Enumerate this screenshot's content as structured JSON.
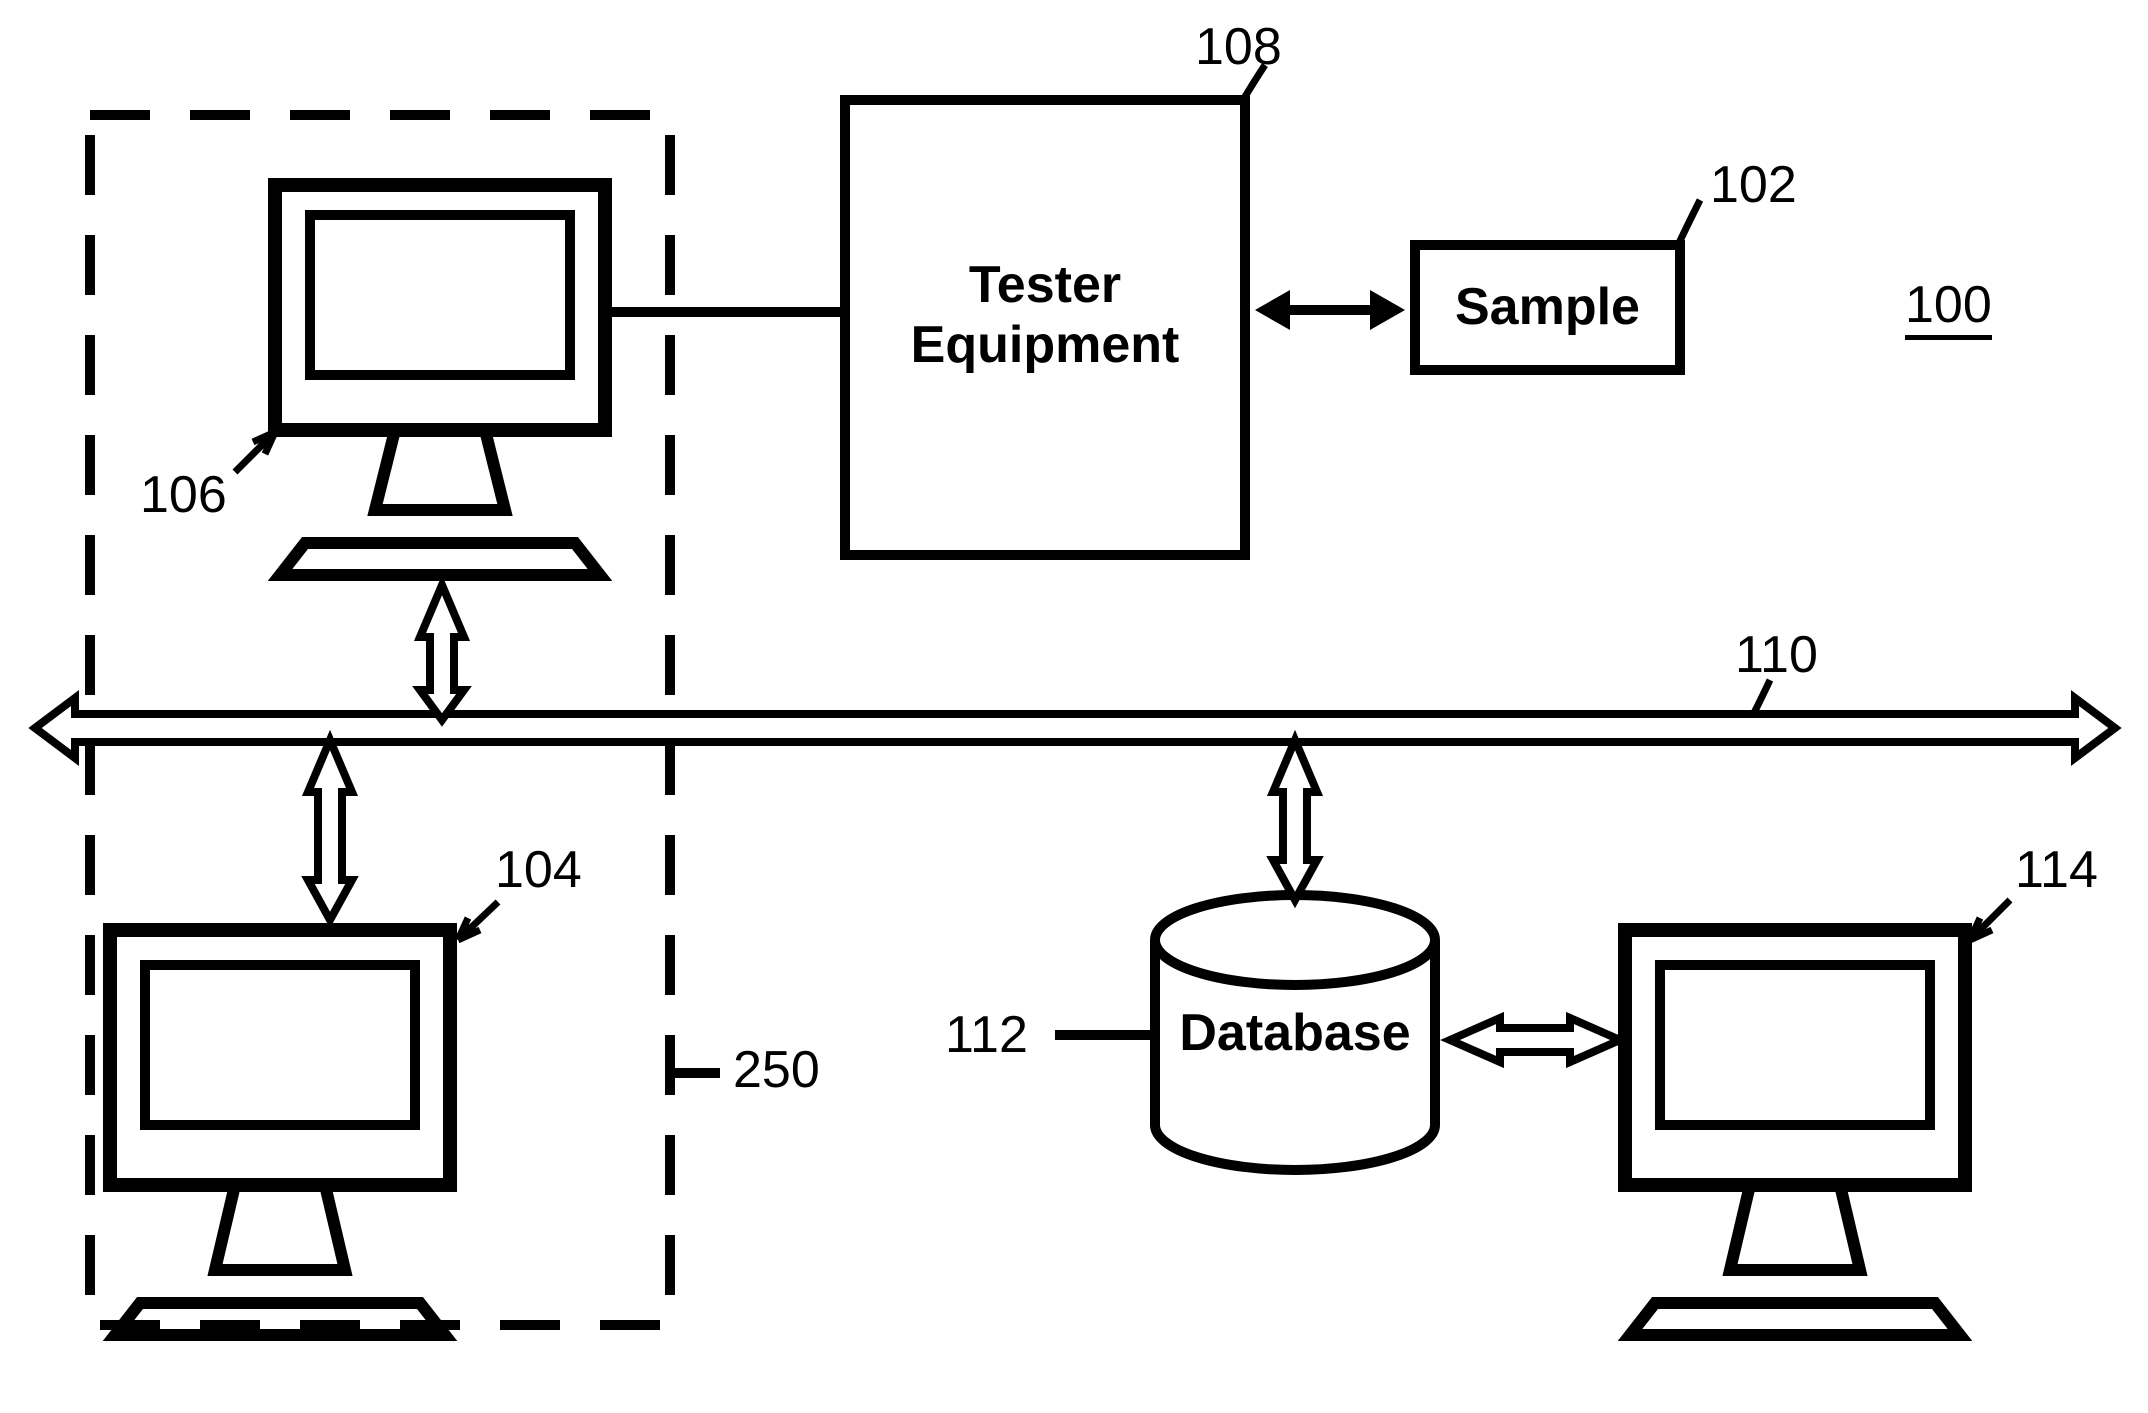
{
  "labels": {
    "tester_equipment_line1": "Tester",
    "tester_equipment_line2": "Equipment",
    "sample": "Sample",
    "database": "Database"
  },
  "refs": {
    "r100": "100",
    "r102": "102",
    "r104": "104",
    "r106": "106",
    "r108": "108",
    "r110": "110",
    "r112": "112",
    "r114": "114",
    "r250": "250"
  }
}
